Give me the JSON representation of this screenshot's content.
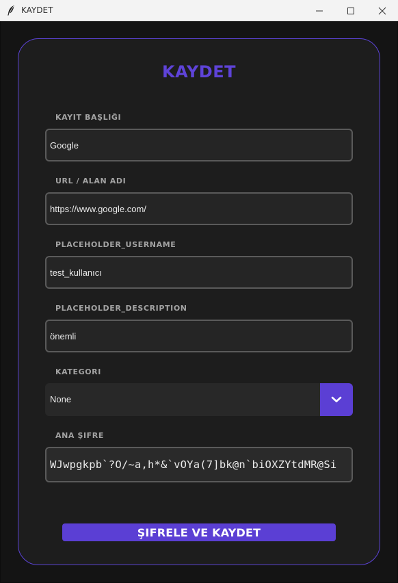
{
  "window": {
    "title": "KAYDET"
  },
  "form": {
    "heading": "KAYDET",
    "fields": [
      {
        "label": "KAYIT BAŞLIĞI",
        "value": "Google"
      },
      {
        "label": "URL / ALAN ADI",
        "value": "https://www.google.com/"
      },
      {
        "label": "PLACEHOLDER_USERNAME",
        "value": "test_kullanıcı"
      },
      {
        "label": "PLACEHOLDER_DESCRIPTION",
        "value": "önemli"
      }
    ],
    "category": {
      "label": "KATEGORI",
      "value": "None"
    },
    "password": {
      "label": "ANA ŞIFRE",
      "value": "WJwpgkpb`?O/~a,h*&`vOYa(7]bk@n`biOXZYtdMR@Si"
    },
    "submit_label": "ŞIFRELE VE KAYDET"
  },
  "colors": {
    "accent": "#5b3fd4",
    "background": "#1d1d1d",
    "field_border": "#5a5a5a"
  },
  "icons": {
    "app": "feather-icon",
    "dropdown": "chevron-down-icon"
  }
}
